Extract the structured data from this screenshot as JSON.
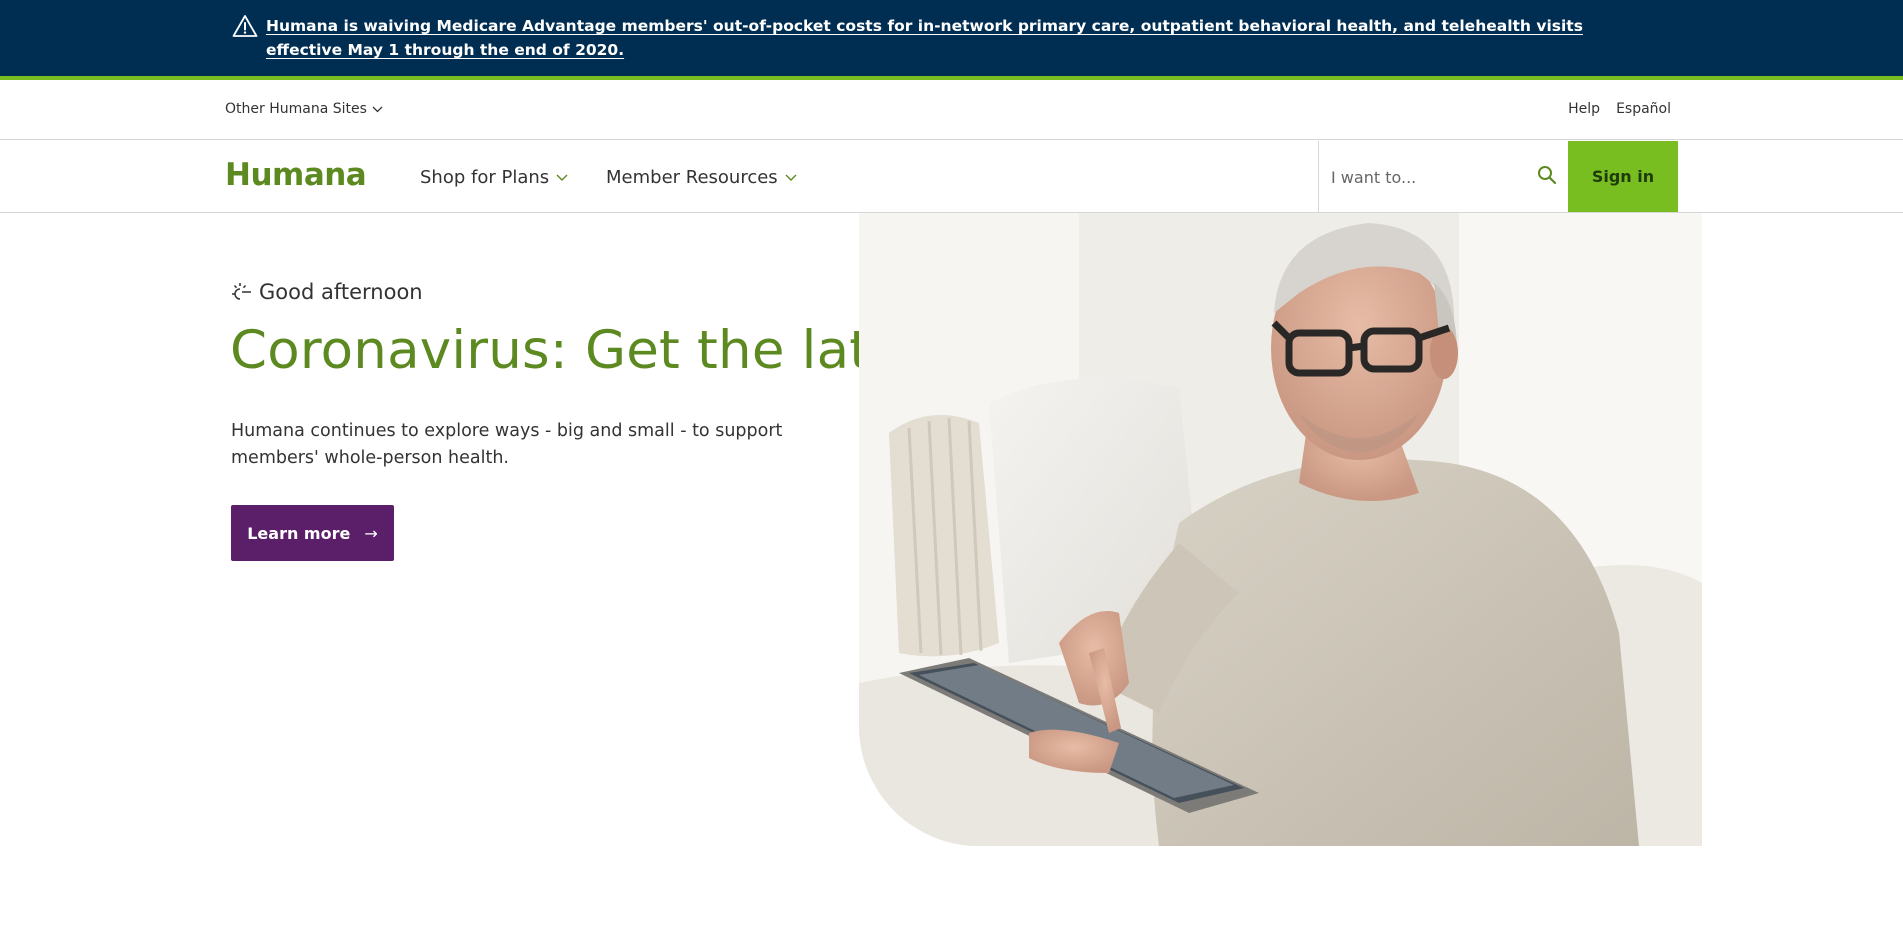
{
  "alert": {
    "icon": "warning-icon",
    "text": "Humana is waiving Medicare Advantage members' out-of-pocket costs for in-network primary care, outpatient behavioral health, and telehealth visits effective May 1 through the end of 2020."
  },
  "utility": {
    "other_sites": "Other Humana Sites",
    "help": "Help",
    "espanol": "Español"
  },
  "nav": {
    "logo": "Humana",
    "shop": "Shop for Plans",
    "member": "Member Resources",
    "search_placeholder": "I want to...",
    "sign_in": "Sign in"
  },
  "hero": {
    "greeting": "Good afternoon",
    "title": "Coronavirus: Get the latest",
    "body": "Humana continues to explore ways - big and small - to support members' whole-person health.",
    "button": "Learn more",
    "image_alt": "man-using-tablet-photo"
  },
  "colors": {
    "banner_bg": "#002d52",
    "accent_green": "#78be20",
    "brand_green": "#5c8a21",
    "button_purple": "#5b1f69"
  }
}
